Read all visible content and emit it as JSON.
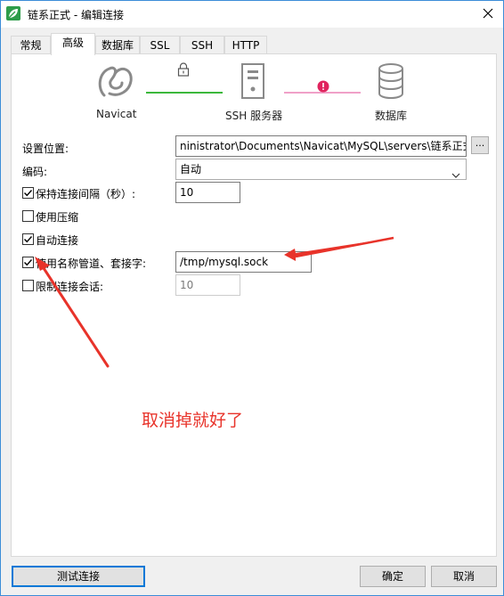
{
  "window": {
    "title": "链系正式 - 编辑连接",
    "icon": "navicat-leaf-icon",
    "accent_color": "#0078d7"
  },
  "tabs": [
    {
      "label": "常规",
      "active": false
    },
    {
      "label": "高级",
      "active": true
    },
    {
      "label": "数据库",
      "active": false
    },
    {
      "label": "SSL",
      "active": false
    },
    {
      "label": "SSH",
      "active": false
    },
    {
      "label": "HTTP",
      "active": false
    }
  ],
  "connection_diagram": {
    "nodes": [
      {
        "label": "Navicat",
        "icon": "navicat-logo-icon"
      },
      {
        "label": "SSH 服务器",
        "icon": "server-icon"
      },
      {
        "label": "数据库",
        "icon": "database-icon"
      }
    ],
    "link1_color": "#3cb83c",
    "link2_color": "#f0a0c8",
    "lock_icon": "lock-icon",
    "error_icon": "error-dot-icon",
    "error_color": "#e0245e"
  },
  "settings": {
    "location": {
      "label": "设置位置:",
      "value": "ninistrator\\Documents\\Navicat\\MySQL\\servers\\链系正式",
      "browse_label": "..."
    },
    "encoding": {
      "label": "编码:",
      "value": "自动"
    },
    "keepalive": {
      "label": "保持连接间隔（秒）:",
      "checked": true,
      "value": "10"
    },
    "compression": {
      "label": "使用压缩",
      "checked": false
    },
    "auto_connect": {
      "label": "自动连接",
      "checked": true
    },
    "named_pipe": {
      "label": "使用名称管道、套接字:",
      "checked": true,
      "value": "/tmp/mysql.sock"
    },
    "session_limit": {
      "label": "限制连接会话:",
      "checked": false,
      "value": "10"
    }
  },
  "annotation": {
    "text": "取消掉就好了",
    "color": "#e8332a"
  },
  "buttons": {
    "test": "测试连接",
    "ok": "确定",
    "cancel": "取消"
  }
}
